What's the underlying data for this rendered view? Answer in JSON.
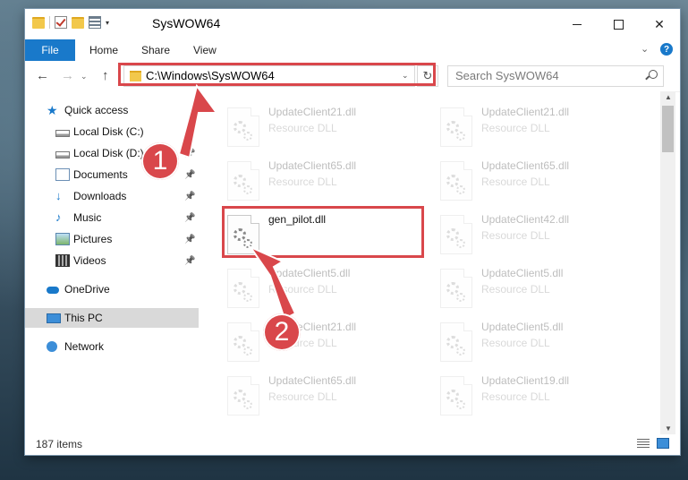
{
  "window": {
    "title": "SysWOW64",
    "quick_access_dropdown": "▾"
  },
  "ribbon": {
    "file": "File",
    "home": "Home",
    "share": "Share",
    "view": "View",
    "help": "?"
  },
  "address": {
    "path": "C:\\Windows\\SysWOW64",
    "search_placeholder": "Search SysWOW64"
  },
  "nav": {
    "items": [
      {
        "label": "Quick access",
        "icon": "star-icon",
        "pinned": false
      },
      {
        "label": "Local Disk (C:)",
        "icon": "drive-icon",
        "pinned": true
      },
      {
        "label": "Local Disk (D:)",
        "icon": "drive-icon",
        "pinned": true
      },
      {
        "label": "Documents",
        "icon": "documents-icon",
        "pinned": true
      },
      {
        "label": "Downloads",
        "icon": "download-icon",
        "pinned": true
      },
      {
        "label": "Music",
        "icon": "music-icon",
        "pinned": true
      },
      {
        "label": "Pictures",
        "icon": "pictures-icon",
        "pinned": true
      },
      {
        "label": "Videos",
        "icon": "videos-icon",
        "pinned": true
      },
      {
        "label": "OneDrive",
        "icon": "cloud-icon",
        "pinned": false
      },
      {
        "label": "This PC",
        "icon": "computer-icon",
        "pinned": false,
        "selected": true
      },
      {
        "label": "Network",
        "icon": "network-icon",
        "pinned": false
      }
    ]
  },
  "files": [
    {
      "name": "UpdateClient21.dll",
      "type": "Resource DLL"
    },
    {
      "name": "UpdateClient21.dll",
      "type": "Resource DLL"
    },
    {
      "name": "UpdateClient65.dll",
      "type": "Resource DLL"
    },
    {
      "name": "UpdateClient65.dll",
      "type": "Resource DLL"
    },
    {
      "name": "gen_pilot.dll",
      "type": ""
    },
    {
      "name": "UpdateClient42.dll",
      "type": "Resource DLL"
    },
    {
      "name": "UpdateClient5.dll",
      "type": "Resource DLL"
    },
    {
      "name": "UpdateClient5.dll",
      "type": "Resource DLL"
    },
    {
      "name": "UpdateClient21.dll",
      "type": "Resource DLL"
    },
    {
      "name": "UpdateClient5.dll",
      "type": "Resource DLL"
    },
    {
      "name": "UpdateClient65.dll",
      "type": "Resource DLL"
    },
    {
      "name": "UpdateClient19.dll",
      "type": "Resource DLL"
    }
  ],
  "status": {
    "item_count": "187 items"
  },
  "annotations": {
    "step1": "1",
    "step2": "2",
    "color": "#d9474b"
  }
}
